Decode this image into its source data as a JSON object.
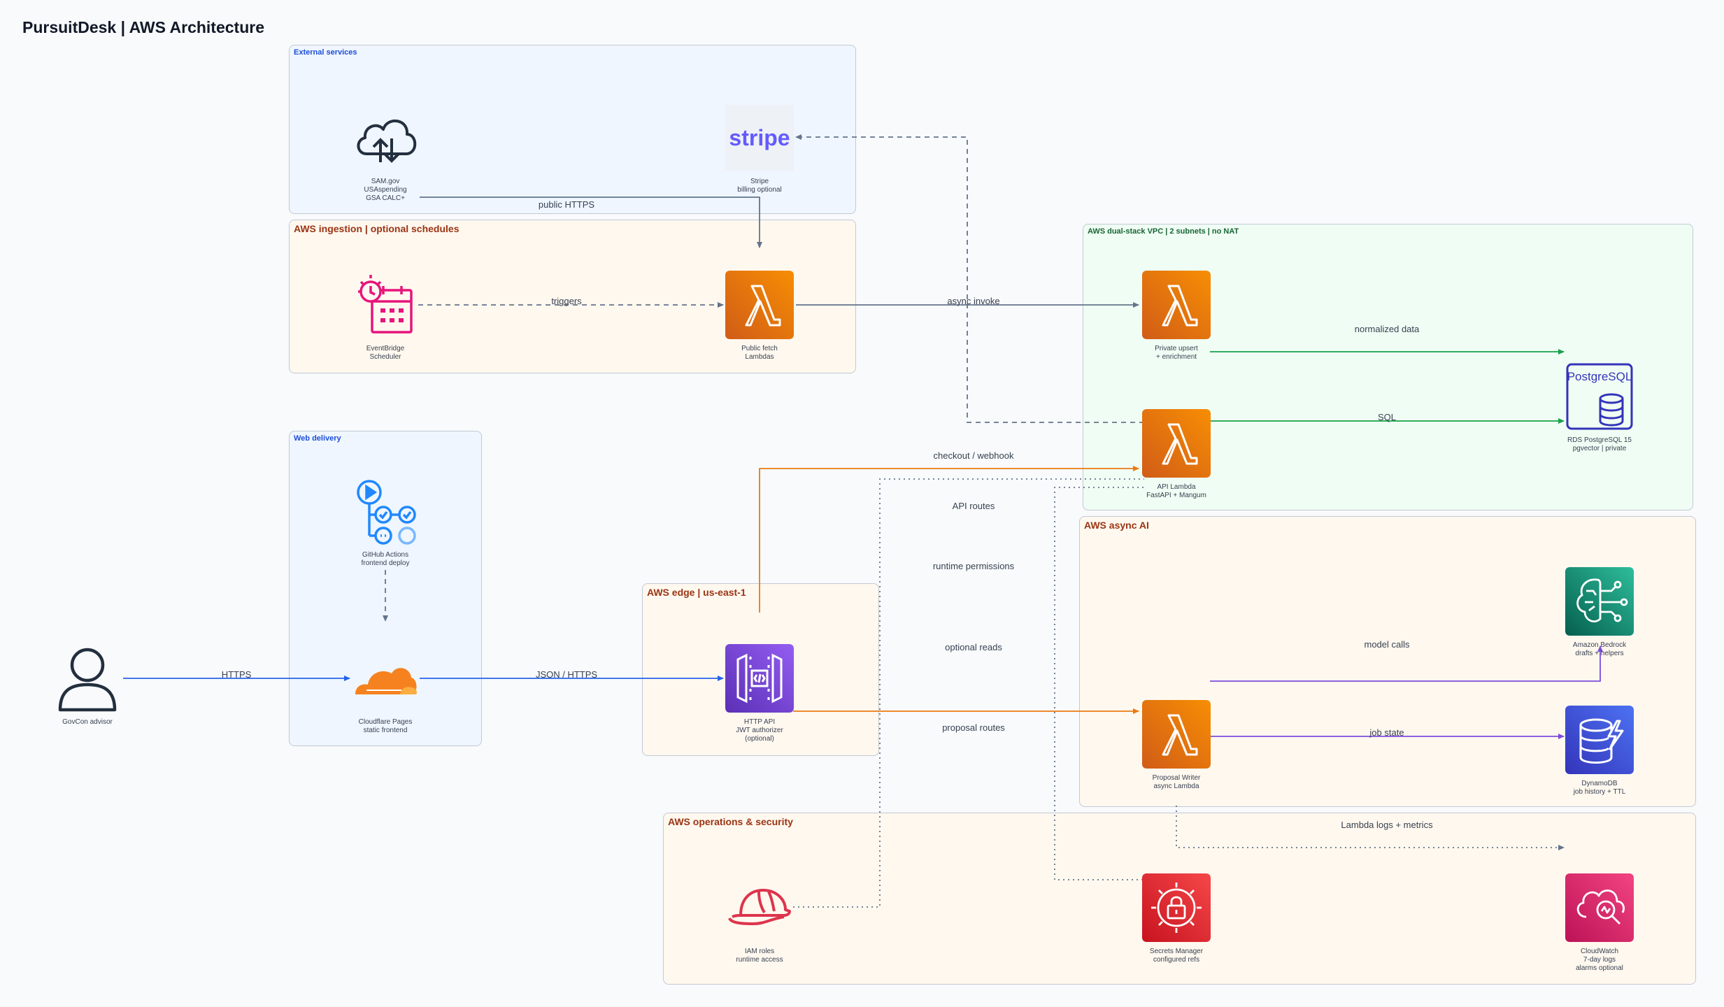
{
  "title": "PursuitDesk | AWS Architecture",
  "groups": {
    "external": "External services",
    "ingestion": "AWS ingestion | optional schedules",
    "vpc": "AWS dual-stack VPC | 2 subnets | no NAT",
    "web": "Web delivery",
    "edge": "AWS edge | us-east-1",
    "async": "AWS async AI",
    "ops": "AWS operations & security"
  },
  "nodes": {
    "samgov": {
      "icon": "cloud-upload-download-icon",
      "lines": [
        "SAM.gov",
        "USAspending",
        "GSA CALC+"
      ]
    },
    "stripe": {
      "icon": "stripe-logo",
      "logo_text": "stripe",
      "lines": [
        "Stripe",
        "billing optional"
      ]
    },
    "eventbridge": {
      "icon": "eventbridge-scheduler-icon",
      "lines": [
        "EventBridge",
        "Scheduler"
      ]
    },
    "public_fetch": {
      "icon": "lambda-icon",
      "lines": [
        "Public fetch",
        "Lambdas"
      ]
    },
    "private_upsert": {
      "icon": "lambda-icon",
      "lines": [
        "Private upsert",
        "+ enrichment"
      ]
    },
    "api_lambda": {
      "icon": "lambda-icon",
      "lines": [
        "API Lambda",
        "FastAPI + Mangum"
      ]
    },
    "rds": {
      "icon": "postgresql-icon",
      "logo_text": "PostgreSQL",
      "lines": [
        "RDS PostgreSQL 15",
        "pgvector | private"
      ]
    },
    "github": {
      "icon": "github-actions-icon",
      "lines": [
        "GitHub Actions",
        "frontend deploy"
      ]
    },
    "cloudflare": {
      "icon": "cloudflare-icon",
      "lines": [
        "Cloudflare Pages",
        "static frontend"
      ]
    },
    "user": {
      "icon": "user-icon",
      "lines": [
        "GovCon advisor"
      ]
    },
    "http_api": {
      "icon": "api-gateway-icon",
      "lines": [
        "HTTP API",
        "JWT authorizer",
        "(optional)"
      ]
    },
    "bedrock": {
      "icon": "bedrock-icon",
      "lines": [
        "Amazon Bedrock",
        "drafts + helpers"
      ]
    },
    "dynamodb": {
      "icon": "dynamodb-icon",
      "lines": [
        "DynamoDB",
        "job history + TTL"
      ]
    },
    "proposal_writer": {
      "icon": "lambda-icon",
      "lines": [
        "Proposal Writer",
        "async Lambda"
      ]
    },
    "iam": {
      "icon": "iam-hardhat-icon",
      "lines": [
        "IAM roles",
        "runtime access"
      ]
    },
    "secrets": {
      "icon": "secrets-manager-icon",
      "lines": [
        "Secrets Manager",
        "configured refs"
      ]
    },
    "cloudwatch": {
      "icon": "cloudwatch-icon",
      "lines": [
        "CloudWatch",
        "7-day logs",
        "alarms optional"
      ]
    }
  },
  "edges": {
    "public_https": "public HTTPS",
    "triggers": "triggers",
    "async_invoke": "async invoke",
    "normalized_data": "normalized data",
    "sql": "SQL",
    "checkout_webhook": "checkout / webhook",
    "api_routes": "API routes",
    "runtime_permissions": "runtime permissions",
    "optional_reads": "optional reads",
    "proposal_routes": "proposal routes",
    "https": "HTTPS",
    "json_https": "JSON / HTTPS",
    "model_calls": "model calls",
    "job_state": "job state",
    "lambda_logs": "Lambda logs + metrics"
  },
  "colors": {
    "lambda_light": "#F78E04",
    "lambda_dark": "#D05C17",
    "api_light": "#945DF2",
    "api_dark": "#5A30B5",
    "bedrock_light": "#2EBD9B",
    "bedrock_dark": "#055F4E",
    "dynamo_light": "#4D72F3",
    "dynamo_dark": "#3334B9",
    "security_light": "#F54749",
    "security_dark": "#C7131F",
    "cloudwatch_light": "#F34482",
    "cloudwatch_dark": "#BC1356",
    "edge_grey": "#64748b",
    "edge_orange": "#ea7a12",
    "edge_green": "#16a34a",
    "edge_blue": "#2563eb",
    "edge_purple": "#7c4ddb"
  }
}
